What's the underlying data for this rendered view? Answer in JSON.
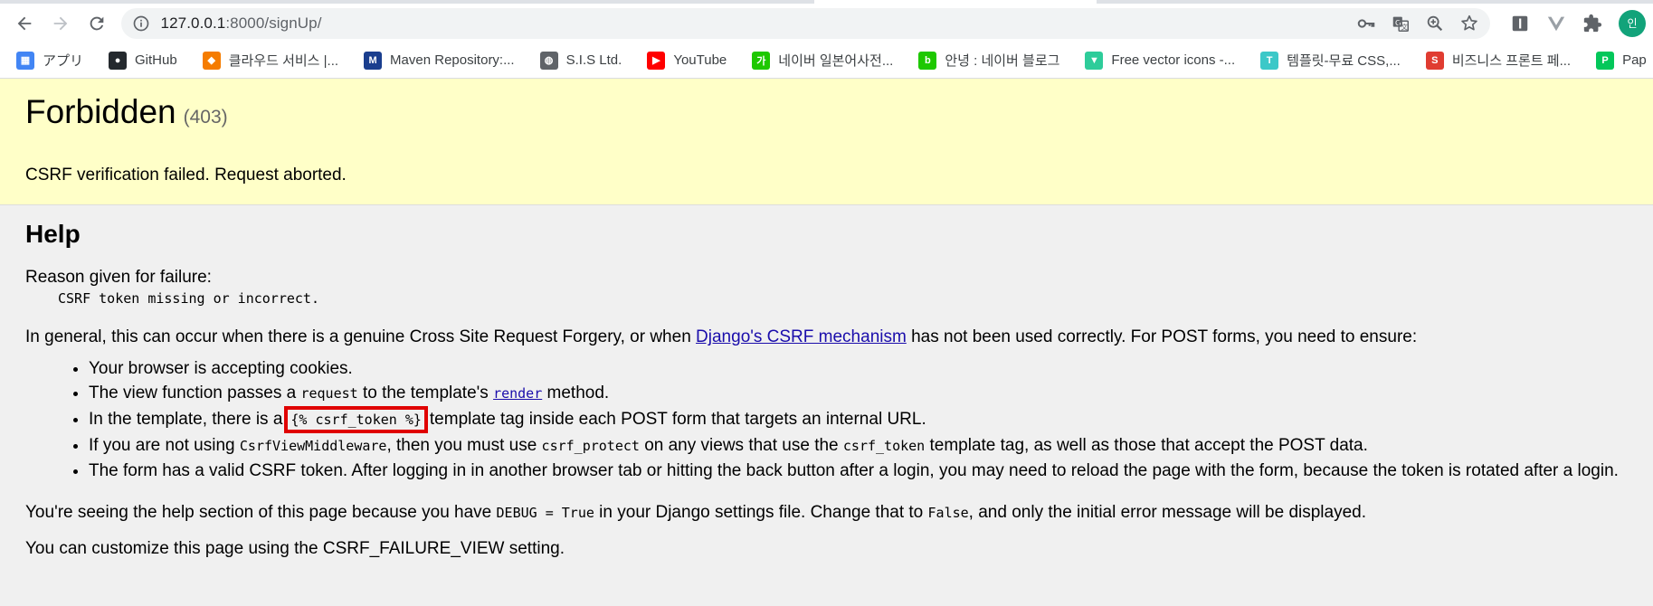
{
  "browser": {
    "url_host": "127.0.0.1",
    "url_path": ":8000/signUp/",
    "profile_initial": "인",
    "bookmarks": [
      {
        "label": "アプリ",
        "icon": "apps-grid-icon",
        "color": "#4285f4"
      },
      {
        "label": "GitHub",
        "icon": "github-icon",
        "color": "#24292e"
      },
      {
        "label": "클라우드 서비스 |...",
        "icon": "cube-icon",
        "color": "#f57c00"
      },
      {
        "label": "Maven Repository:...",
        "icon": "mvn-icon",
        "color": "#1a3e8e"
      },
      {
        "label": "S.I.S Ltd.",
        "icon": "globe-icon",
        "color": "#5f6368"
      },
      {
        "label": "YouTube",
        "icon": "youtube-icon",
        "color": "#ff0000"
      },
      {
        "label": "네이버 일본어사전...",
        "icon": "naver-dict-icon",
        "color": "#1ec800"
      },
      {
        "label": "안녕 : 네이버 블로그",
        "icon": "naver-blog-icon",
        "color": "#1ec800"
      },
      {
        "label": "Free vector icons -...",
        "icon": "flaticon-icon",
        "color": "#2ecc9a"
      },
      {
        "label": "템플릿-무료 CSS,...",
        "icon": "template-icon",
        "color": "#3cc8c8"
      },
      {
        "label": "비즈니스 프론트 페...",
        "icon": "s-brand-icon",
        "color": "#e03c31"
      },
      {
        "label": "Pap",
        "icon": "papago-icon",
        "color": "#03c75a"
      }
    ]
  },
  "error": {
    "title": "Forbidden",
    "code": "(403)",
    "message": "CSRF verification failed. Request aborted."
  },
  "help": {
    "heading": "Help",
    "reason_label": "Reason given for failure:",
    "reason_text": "CSRF token missing or incorrect.",
    "general_before": "In general, this can occur when there is a genuine Cross Site Request Forgery, or when ",
    "general_link": "Django's CSRF mechanism",
    "general_after": " has not been used correctly. For POST forms, you need to ensure:",
    "item1": "Your browser is accepting cookies.",
    "item2_a": "The view function passes a ",
    "item2_code": "request",
    "item2_b": " to the template's ",
    "item2_link": "render",
    "item2_c": " method.",
    "item3_a": "In the template, there is a",
    "item3_code": "{% csrf_token %}",
    "item3_b": "template tag inside each POST form that targets an internal URL.",
    "item4_a": "If you are not using ",
    "item4_code1": "CsrfViewMiddleware",
    "item4_b": ", then you must use ",
    "item4_code2": "csrf_protect",
    "item4_c": " on any views that use the ",
    "item4_code3": "csrf_token",
    "item4_d": " template tag, as well as those that accept the POST data.",
    "item5": "The form has a valid CSRF token. After logging in in another browser tab or hitting the back button after a login, you may need to reload the page with the form, because the token is rotated after a login.",
    "debug_a": "You're seeing the help section of this page because you have ",
    "debug_code1": "DEBUG = True",
    "debug_b": " in your Django settings file. Change that to ",
    "debug_code2": "False",
    "debug_c": ", and only the initial error message will be displayed.",
    "customize": "You can customize this page using the CSRF_FAILURE_VIEW setting."
  }
}
